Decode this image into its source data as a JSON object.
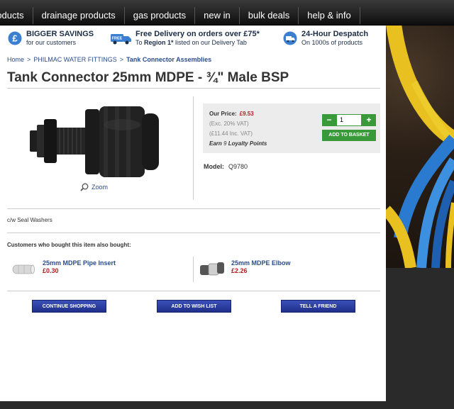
{
  "nav": {
    "items": [
      "roducts",
      "drainage products",
      "gas products",
      "new in",
      "bulk deals",
      "help & info"
    ]
  },
  "promos": [
    {
      "title": "BIGGER SAVINGS",
      "sub": "for our customers"
    },
    {
      "title": "Free Delivery on orders over £75*",
      "sub_pre": "To ",
      "sub_bold": "Region 1*",
      "sub_post": " listed on our Delivery Tab"
    },
    {
      "title": "24-Hour Despatch",
      "sub": "On 1000s of products"
    }
  ],
  "breadcrumb": {
    "home": "Home",
    "cat": "PHILMAC WATER FITTINGS",
    "current": "Tank Connector Assemblies",
    "sep": ">"
  },
  "product": {
    "title": "Tank Connector 25mm MDPE - ¾\" Male BSP",
    "zoom": "Zoom",
    "price_label": "Our Price:",
    "price": "£9.53",
    "exvat": "(Exc. 20% VAT)",
    "incvat": "(£11.44 Inc. VAT)",
    "loyalty_pre": "Earn ",
    "loyalty_num": "9",
    "loyalty_post": " Loyalty Points",
    "qty": "1",
    "minus": "−",
    "plus": "+",
    "add_basket": "ADD TO BASKET",
    "model_label": "Model:",
    "model": "Q9780",
    "desc": "c/w Seal Washers"
  },
  "also": {
    "heading": "Customers who bought this item also bought:",
    "items": [
      {
        "name": "25mm MDPE Pipe Insert",
        "price": "£0.30"
      },
      {
        "name": "25mm MDPE Elbow",
        "price": "£2.26"
      }
    ]
  },
  "actions": {
    "continue": "CONTINUE SHOPPING",
    "wishlist": "ADD TO WISH LIST",
    "friend": "TELL A FRIEND"
  },
  "colors": {
    "accent_green": "#3a9a3a",
    "price_red": "#b02020",
    "link_blue": "#2b4c8c",
    "button_blue": "#2a3da0"
  }
}
